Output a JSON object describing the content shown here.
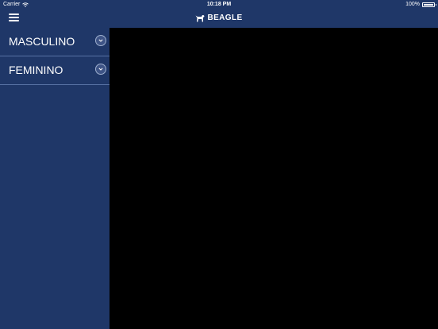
{
  "status_bar": {
    "carrier": "Carrier",
    "time": "10:18 PM",
    "battery": "100%",
    "battery_level": 1.0
  },
  "header": {
    "brand": "BEAGLE",
    "menu_icon": "hamburger-icon",
    "logo_icon": "beagle-dog-icon"
  },
  "sidebar": {
    "items": [
      {
        "label": "MASCULINO",
        "icon": "chevron-down-icon"
      },
      {
        "label": "FEMININO",
        "icon": "chevron-down-icon"
      }
    ]
  },
  "colors": {
    "nav": "#1f3768",
    "divider": "#5872a4",
    "content": "#000000",
    "text": "#ffffff"
  }
}
